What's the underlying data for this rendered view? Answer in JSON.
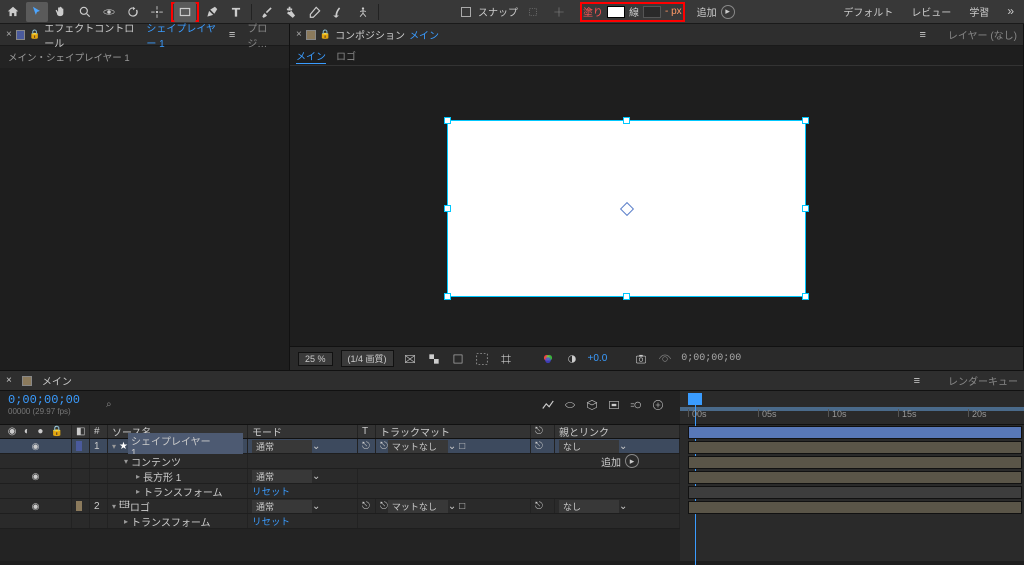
{
  "toolbar": {
    "snap_label": "スナップ",
    "fill_label": "塗り",
    "stroke_label": "線",
    "stroke_px": "- px",
    "add_label": "追加"
  },
  "workspace": {
    "default": "デフォルト",
    "review": "レビュー",
    "learn": "学習"
  },
  "left_panel": {
    "tab1": "エフェクトコントロール",
    "layer_link": "シェイプレイヤー 1",
    "tab2": "プロジ…",
    "sub": "メイン・シェイプレイヤー 1"
  },
  "right_panel": {
    "tab": "コンポジション",
    "comp_link": "メイン",
    "layer_tab": "レイヤー (なし)",
    "comp_tab1": "メイン",
    "comp_tab2": "ロゴ"
  },
  "viewer_bar": {
    "zoom": "25 %",
    "res": "(1/4 画質)",
    "exposure": "+0.0",
    "time": "0;00;00;00"
  },
  "timeline": {
    "tab1": "メイン",
    "tab2": "レンダーキュー",
    "timecode": "0;00;00;00",
    "fps": "00000 (29.97 fps)",
    "search_placeholder": "⌕",
    "hdr": {
      "num": "#",
      "name": "ソース名",
      "mode": "モード",
      "t": "T",
      "track": "トラックマット",
      "parent": "親とリンク"
    },
    "layers": [
      {
        "n": "1",
        "name": "シェイプレイヤー 1",
        "mode": "通常",
        "track": "マットなし",
        "parent": "なし",
        "color": "#4a5a9c"
      },
      {
        "name": "コンテンツ",
        "add": "追加"
      },
      {
        "name": "長方形 1",
        "mode": "通常"
      },
      {
        "name": "トランスフォーム",
        "reset": "リセット"
      },
      {
        "n": "2",
        "name": "ロゴ",
        "mode": "通常",
        "track": "マットなし",
        "parent": "なし",
        "color": "#8b7a5c"
      },
      {
        "name": "トランスフォーム",
        "reset": "リセット"
      }
    ],
    "ruler": [
      "00s",
      "05s",
      "10s",
      "15s",
      "20s"
    ]
  }
}
